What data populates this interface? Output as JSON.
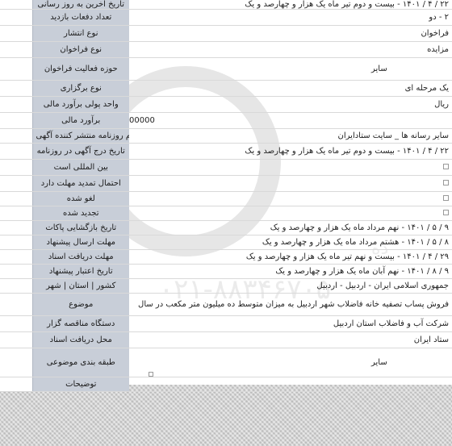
{
  "rows": [
    {
      "label": "تاریخ آخرین به روز رسانی",
      "value": "۲۲ / ۴ / ۱۴۰۱ - بیست و دوم تیر ماه یک هزار و چهارصد و یک"
    },
    {
      "label": "تعداد دفعات بازدید",
      "value": "۲ - دو"
    },
    {
      "label": "نوع انتشار",
      "value": "فراخوان"
    },
    {
      "label": "نوع فراخوان",
      "value": "مزایده"
    },
    {
      "label": "حوزه فعالیت فراخوان",
      "value": "سایر"
    },
    {
      "label": "نوع برگزاری",
      "value": "یک مرحله ای"
    },
    {
      "label": "واحد پولی برآورد مالی",
      "value": "ریال"
    },
    {
      "label": "برآورد مالی",
      "value": "00000"
    },
    {
      "label": "نام روزنامه منتشر کننده آگهی",
      "value": "سایر رسانه ها _ سایت ستادایران"
    },
    {
      "label": "تاریخ درج آگهی در روزنامه",
      "value": "۲۲ / ۴ / ۱۴۰۱ - بیست و دوم تیر ماه یک هزار و چهارصد و یک"
    },
    {
      "label": "بین المللی است",
      "value": ""
    },
    {
      "label": "احتمال تمدید مهلت دارد",
      "value": ""
    },
    {
      "label": "لغو شده",
      "value": ""
    },
    {
      "label": "تجدید شده",
      "value": ""
    },
    {
      "label": "تاریخ بازگشایی پاکات",
      "value": "۹ / ۵ / ۱۴۰۱ - نهم مرداد ماه یک هزار و چهارصد و یک"
    },
    {
      "label": "مهلت ارسال پیشنهاد",
      "value": "۸ / ۵ / ۱۴۰۱ - هشتم مرداد ماه یک هزار و چهارصد و یک"
    },
    {
      "label": "مهلت دریافت اسناد",
      "value": "۲۹ / ۴ / ۱۴۰۱ - بیست و نهم تیر ماه یک هزار و چهارصد و یک"
    },
    {
      "label": "تاریخ اعتبار پیشنهاد",
      "value": "۹ / ۸ / ۱۴۰۱ - نهم آبان ماه یک هزار و چهارصد و یک"
    },
    {
      "label": "کشور | استان | شهر",
      "value": "جمهوری اسلامی ایران - اردبیل - اردبیل"
    },
    {
      "label": "موضوع",
      "value": "فروش پساب تصفیه خانه فاضلاب شهر اردبیل به میزان متوسط ده میلیون متر مکعب در سال"
    },
    {
      "label": "دستگاه مناقصه گزار",
      "value": "شرکت آب و فاضلاب استان اردبیل"
    },
    {
      "label": "محل دریافت اسناد",
      "value": "ستاد ایران"
    },
    {
      "label": "طبقه بندی موضوعی",
      "value": "سایر"
    },
    {
      "label": "توضیحات",
      "value": ""
    }
  ],
  "watermark": {
    "line1": "پایگاه ملی اطلاع رسانی مناقصه و مزایده",
    "phone": "۰۲۱-۸۸۳۴۶۷۰۵"
  }
}
